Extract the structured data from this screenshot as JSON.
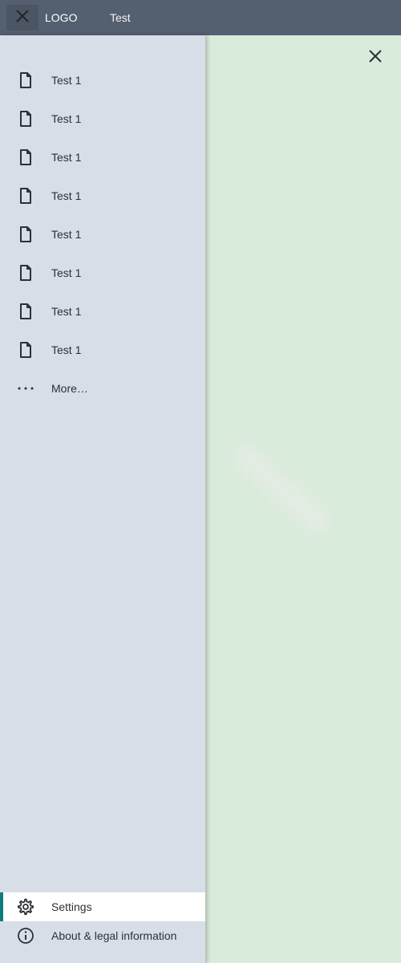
{
  "header": {
    "logo": "LOGO",
    "title": "Test",
    "close_icon": "close-icon"
  },
  "sidebar": {
    "items": [
      {
        "label": "Test 1",
        "icon": "document-icon"
      },
      {
        "label": "Test 1",
        "icon": "document-icon"
      },
      {
        "label": "Test 1",
        "icon": "document-icon"
      },
      {
        "label": "Test 1",
        "icon": "document-icon"
      },
      {
        "label": "Test 1",
        "icon": "document-icon"
      },
      {
        "label": "Test 1",
        "icon": "document-icon"
      },
      {
        "label": "Test 1",
        "icon": "document-icon"
      },
      {
        "label": "Test 1",
        "icon": "document-icon"
      }
    ],
    "more": {
      "label": "More…",
      "icon": "more-horizontal-icon"
    },
    "bottom": [
      {
        "label": "Settings",
        "icon": "gear-icon",
        "active": true
      },
      {
        "label": "About & legal information",
        "icon": "info-icon",
        "active": false
      }
    ]
  },
  "content": {
    "close_icon": "close-icon"
  },
  "colors": {
    "topbar": "#545f6f",
    "sidebar": "#d7dee8",
    "content_background": "#d9ebda",
    "active_indicator": "#0f7c79"
  }
}
